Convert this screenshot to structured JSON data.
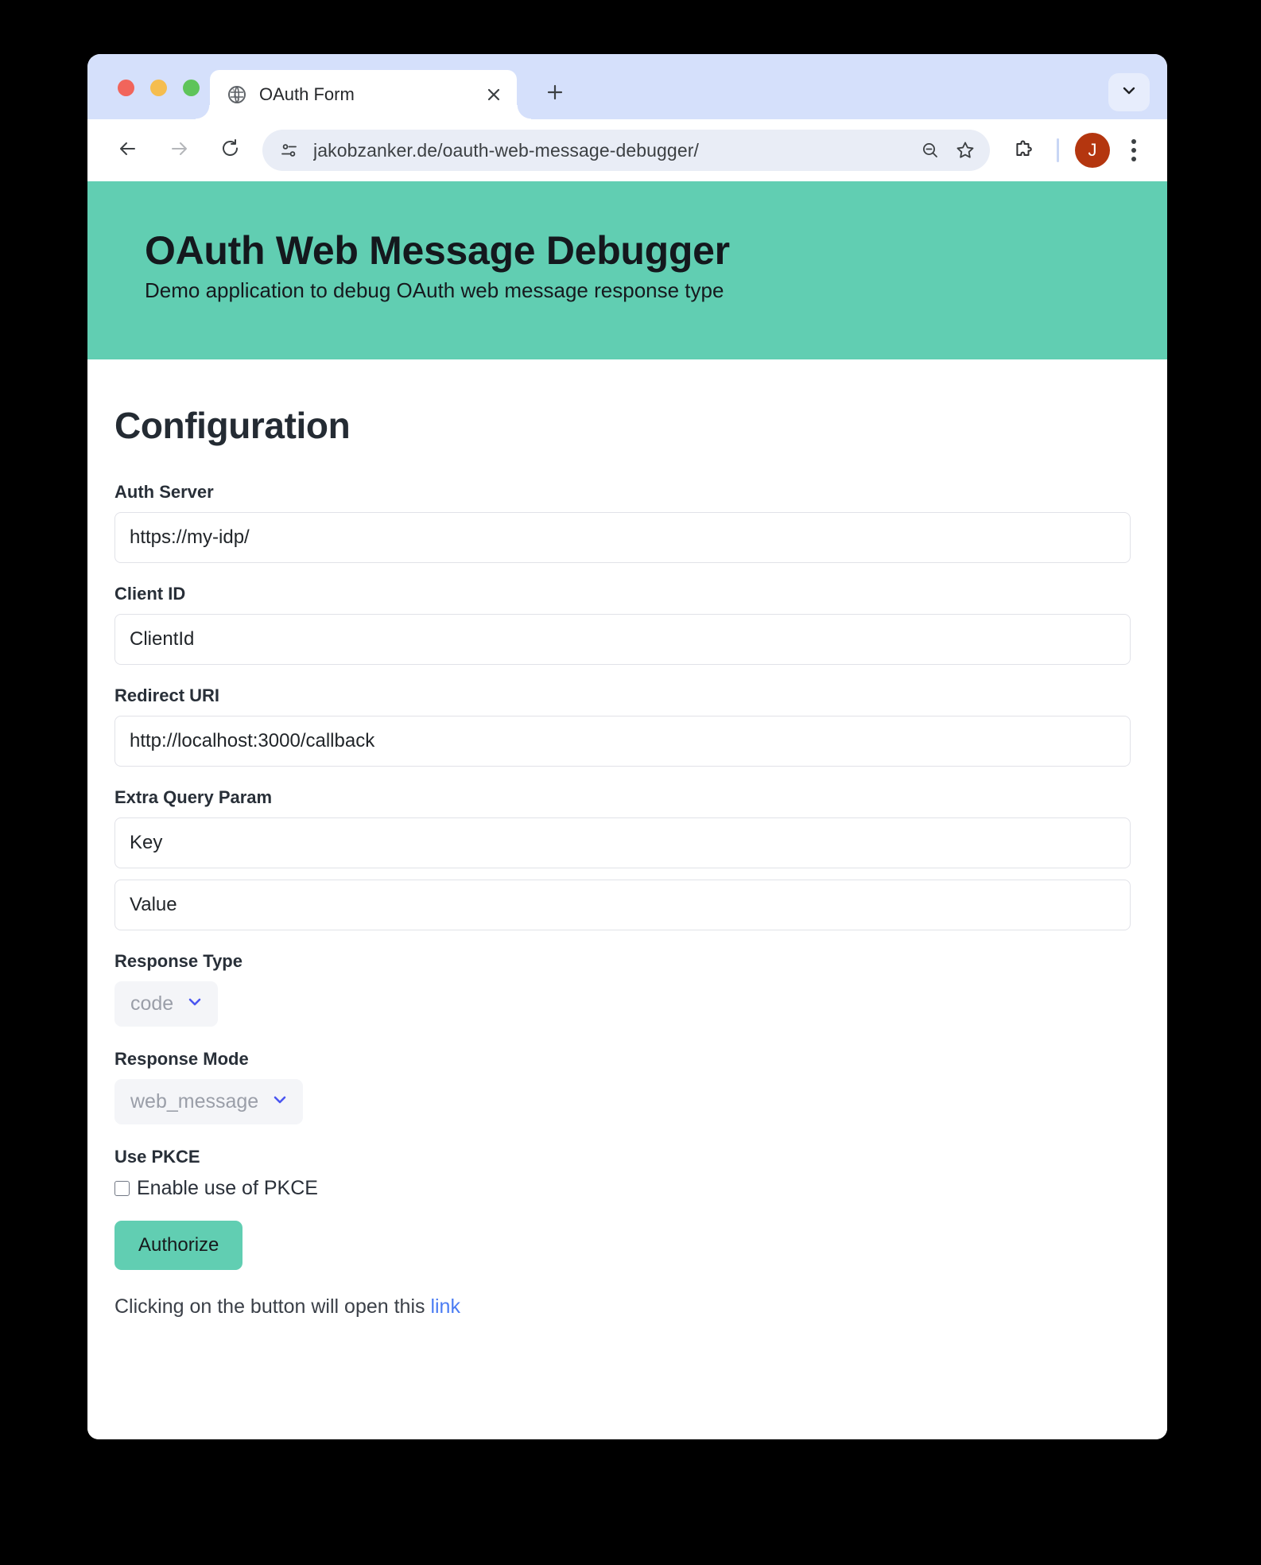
{
  "browser": {
    "tab": {
      "title": "OAuth Form",
      "favicon_icon": "globe-icon",
      "close_icon": "close-icon"
    },
    "new_tab_icon": "plus-icon",
    "tab_search_icon": "chevron-down-icon",
    "nav": {
      "back_icon": "arrow-left-icon",
      "forward_icon": "arrow-right-icon",
      "reload_icon": "reload-icon"
    },
    "omnibox": {
      "site_info_icon": "page-settings-icon",
      "url": "jakobzanker.de/oauth-web-message-debugger/",
      "zoom_out_icon": "zoom-out-icon",
      "bookmark_icon": "star-icon"
    },
    "toolbar_right": {
      "extensions_icon": "puzzle-piece-icon",
      "avatar_initial": "J",
      "avatar_color": "#b4360f",
      "menu_icon": "three-dot-menu-icon"
    }
  },
  "page": {
    "header": {
      "title": "OAuth Web Message Debugger",
      "subtitle": "Demo application to debug OAuth web message response type",
      "background_color": "#61ceb2"
    },
    "heading": "Configuration",
    "fields": {
      "auth_server": {
        "label": "Auth Server",
        "value": "https://my-idp/",
        "placeholder": "https://my-idp/"
      },
      "client_id": {
        "label": "Client ID",
        "value": "ClientId",
        "placeholder": "ClientId"
      },
      "redirect_uri": {
        "label": "Redirect URI",
        "value": "http://localhost:3000/callback",
        "placeholder": "http://localhost:3000/callback"
      },
      "extra_query_param": {
        "label": "Extra Query Param",
        "key": {
          "value": "Key",
          "placeholder": "Key"
        },
        "value_field": {
          "value": "Value",
          "placeholder": "Value"
        }
      },
      "response_type": {
        "label": "Response Type",
        "selected": "code",
        "options": [
          "code"
        ],
        "chevron_icon": "chevron-down-icon"
      },
      "response_mode": {
        "label": "Response Mode",
        "selected": "web_message",
        "options": [
          "web_message"
        ],
        "chevron_icon": "chevron-down-icon"
      },
      "use_pkce": {
        "label": "Use PKCE",
        "checkbox_label": "Enable use of PKCE",
        "checked": false
      }
    },
    "authorize_button": "Authorize",
    "footer": {
      "note_prefix": "Clicking on the button will open this ",
      "link_text": "link",
      "link_color": "#4b7cf3"
    }
  }
}
